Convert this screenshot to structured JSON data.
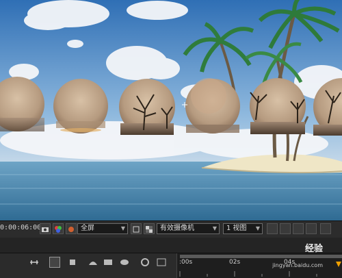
{
  "composition_viewer": {
    "scene": "beach-island-with-palm-trees",
    "ornaments_count_visible": 6
  },
  "comp_toolbar": {
    "timecode": "0:00:06:00",
    "resolution": "全屏",
    "camera": "有效摄像机",
    "view_layout": "1 视图"
  },
  "timeline": {
    "tick_labels": [
      ":00s",
      "02s",
      "04s"
    ]
  },
  "watermark": {
    "brand": "经验",
    "url": "jingyan.baidu.com"
  },
  "colors": {
    "sky": "#3f7fbe",
    "sea": "#4f8fb2",
    "sand": "#efe6c6",
    "ui_dark": "#2c2c2c",
    "accent_orange": "#f0a000"
  }
}
